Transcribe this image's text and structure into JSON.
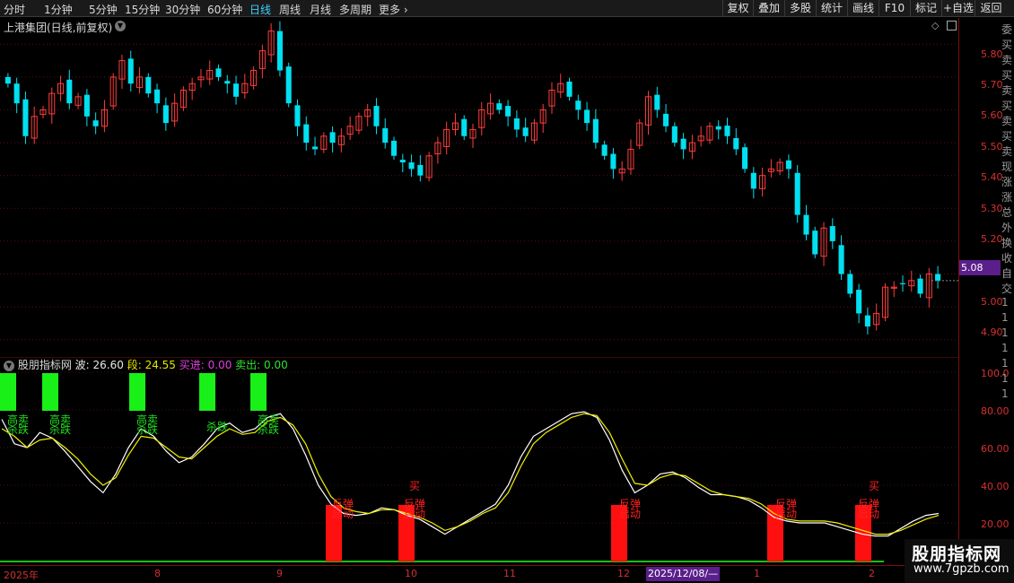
{
  "toolbar": {
    "periods": [
      "分时",
      "1分钟",
      "5分钟",
      "15分钟",
      "30分钟",
      "60分钟",
      "日线",
      "周线",
      "月线",
      "多周期",
      "更多"
    ],
    "active_period": "日线",
    "more_chevron": "›",
    "buttons": [
      "复权",
      "叠加",
      "多股",
      "统计",
      "画线",
      "F10",
      "标记",
      "+自选",
      "返回"
    ]
  },
  "main": {
    "title": "上港集团(日线,前复权)",
    "price_ticks": [
      "5.80",
      "5.70",
      "5.60",
      "5.50",
      "5.40",
      "5.30",
      "5.20",
      "5.10",
      "5.00",
      "4.90"
    ],
    "current_price": "5.08"
  },
  "indicator": {
    "name": "股朋指标网",
    "bo_label": "波: 26.60",
    "duan_label": "段: 24.55",
    "buy_label": "买进: 0.00",
    "sell_label": "卖出: 0.00",
    "ticks": [
      "100.0",
      "80.00",
      "60.00",
      "40.00",
      "20.00"
    ],
    "sig_gaomao": "高卖",
    "sig_shadie": "杀跌",
    "sig_mai": "买",
    "sig_fantan": "反弹",
    "sig_qidong": "启动"
  },
  "xaxis": {
    "labels": [
      "2025年",
      "8",
      "9",
      "10",
      "11",
      "12",
      "2025/12/08/—",
      "1",
      "2"
    ]
  },
  "right_strip": {
    "chars": [
      "委",
      "买",
      "卖",
      "买",
      "卖",
      "买",
      "卖",
      "买",
      "卖",
      "现",
      "涨",
      "涨",
      "总",
      "外",
      "换",
      "收",
      "自",
      "交",
      "1",
      "1",
      "1",
      "1",
      "1",
      "1",
      "1"
    ]
  },
  "watermark": {
    "name": "股朋指标网",
    "url": "www.7gpzb.com"
  },
  "colors": {
    "up": "#ff3c3c",
    "down": "#00e0f0",
    "green": "#18f018",
    "red": "#ff1010",
    "white_line": "#ffffff",
    "yellow_line": "#f0f000",
    "accent_purple": "#5a1f8a",
    "axis_red": "#d83030"
  },
  "chart_data": [
    {
      "type": "candlestick",
      "title": "上港集团(日线,前复权)",
      "ylim": [
        4.85,
        5.88
      ],
      "y_ticks": [
        5.8,
        5.7,
        5.6,
        5.5,
        5.4,
        5.3,
        5.2,
        5.1,
        5.0,
        4.9
      ],
      "last_price": 5.08,
      "closes": [
        5.68,
        5.62,
        5.52,
        5.58,
        5.6,
        5.65,
        5.68,
        5.62,
        5.64,
        5.58,
        5.55,
        5.6,
        5.7,
        5.75,
        5.68,
        5.7,
        5.65,
        5.62,
        5.56,
        5.62,
        5.66,
        5.68,
        5.7,
        5.72,
        5.7,
        5.68,
        5.64,
        5.68,
        5.72,
        5.78,
        5.84,
        5.72,
        5.62,
        5.55,
        5.5,
        5.48,
        5.52,
        5.5,
        5.52,
        5.55,
        5.58,
        5.6,
        5.55,
        5.5,
        5.46,
        5.44,
        5.42,
        5.4,
        5.46,
        5.5,
        5.54,
        5.56,
        5.52,
        5.54,
        5.6,
        5.62,
        5.6,
        5.58,
        5.54,
        5.52,
        5.56,
        5.6,
        5.66,
        5.68,
        5.64,
        5.6,
        5.56,
        5.5,
        5.46,
        5.42,
        5.42,
        5.48,
        5.56,
        5.64,
        5.6,
        5.55,
        5.5,
        5.48,
        5.5,
        5.52,
        5.55,
        5.54,
        5.52,
        5.48,
        5.42,
        5.36,
        5.4,
        5.42,
        5.44,
        5.42,
        5.28,
        5.22,
        5.16,
        5.24,
        5.2,
        5.1,
        5.04,
        4.98,
        4.94,
        4.98,
        5.06,
        5.06,
        5.07,
        5.08,
        5.04,
        5.1,
        5.08
      ]
    },
    {
      "type": "line",
      "ylim": [
        0,
        100
      ],
      "y_ticks": [
        100,
        80,
        60,
        40,
        20
      ],
      "series": [
        {
          "name": "波",
          "values": [
            75,
            62,
            60,
            68,
            65,
            58,
            50,
            42,
            36,
            46,
            60,
            70,
            66,
            58,
            52,
            55,
            62,
            70,
            73,
            68,
            70,
            76,
            78,
            70,
            56,
            40,
            30,
            25,
            24,
            25,
            28,
            27,
            24,
            22,
            18,
            14,
            18,
            22,
            26,
            30,
            40,
            55,
            66,
            70,
            74,
            78,
            79,
            76,
            64,
            48,
            36,
            40,
            46,
            47,
            44,
            39,
            35,
            35,
            34,
            32,
            28,
            23,
            21,
            20,
            20,
            20,
            18,
            16,
            14,
            13,
            13,
            17,
            21,
            24,
            25
          ]
        },
        {
          "name": "段",
          "values": [
            70,
            66,
            60,
            64,
            65,
            60,
            54,
            46,
            40,
            44,
            56,
            66,
            65,
            60,
            55,
            54,
            60,
            66,
            70,
            67,
            68,
            74,
            76,
            72,
            62,
            46,
            34,
            28,
            26,
            25,
            27,
            27,
            25,
            23,
            20,
            16,
            18,
            21,
            25,
            28,
            36,
            50,
            62,
            68,
            72,
            76,
            78,
            77,
            68,
            54,
            41,
            40,
            44,
            46,
            45,
            41,
            37,
            35,
            34,
            33,
            30,
            25,
            22,
            21,
            21,
            21,
            20,
            18,
            16,
            14,
            14,
            16,
            19,
            22,
            24
          ]
        }
      ],
      "green_bars_x": [
        8,
        55,
        152,
        230,
        287
      ],
      "red_bars_x": [
        372,
        453,
        690,
        864,
        962
      ]
    }
  ]
}
